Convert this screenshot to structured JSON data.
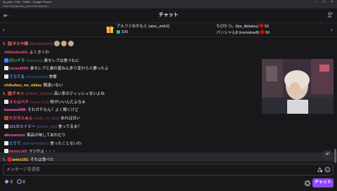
{
  "browser": {
    "title": "ky_yuko - Peer - Twitch - Google Chrome",
    "url": "twitch.tv/popout/ky_yuko/chat?popout="
  },
  "header": {
    "title": "チャット",
    "left_icon": "collapse-icon",
    "right_icon": "users-icon"
  },
  "gifters": [
    {
      "name": "アルファおかもと (atsu_shih2)",
      "count": "100",
      "badge": "sub"
    },
    {
      "name": "ちびたつ。(fps_tibitatsu)",
      "count": "50",
      "badge": "gem"
    },
    {
      "name": "パンシャん8 (iromokas8)",
      "count": "50",
      "badge": "gem"
    }
  ],
  "messages": [
    {
      "prefix": "5.",
      "name": "タヌキ鍋",
      "login": "(tanukikawa)",
      "text": ":",
      "color": "#ff6b6b",
      "badge": "#b0413e",
      "emotes": true
    },
    {
      "prefix": "",
      "name": "shitsuboo01",
      "login": "",
      "text": ": よくきくわ",
      "color": "#ff4f8b",
      "badge": ""
    },
    {
      "prefix": "",
      "name": "けいドラ",
      "login": "(keidora)",
      "text": ": 鼻セレブは食べもに",
      "color": "#39d98a",
      "badge": "#3b82f6"
    },
    {
      "prefix": "",
      "name": "lucas4000",
      "login": "",
      "text": ": 鼻セレブと鼻の羞ねん多り変わら人勝ったよ",
      "color": "#ff4f8b",
      "badge": "#e9e9ec"
    },
    {
      "prefix": "",
      "name": "てらてる",
      "login": "(teraterudo)",
      "text": ": 常備",
      "color": "#5b9bff",
      "badge": "#e9e9ec"
    },
    {
      "prefix": "",
      "name": "chikuhou_no_okina",
      "login": "",
      "text": ": 間違いない",
      "color": "#ffd24d",
      "badge": ""
    },
    {
      "prefix": "5.",
      "name": "チキン",
      "login": "(chiken_chichi)",
      "text": ": 高い系のティッシュ甘いよね",
      "color": "#ff6b6b",
      "badge": "#b0413e"
    },
    {
      "prefix": "",
      "name": "ヌル山ペチ",
      "login": "(nuru_bei)",
      "text": ": 粉がいいんだよなぁ",
      "color": "#ff4f8b",
      "badge": "#e9e9ec"
    },
    {
      "prefix": "",
      "name": "kaname098",
      "login": "",
      "text": ": それガチなん？よく聞くけど",
      "color": "#ff66cc",
      "badge": ""
    },
    {
      "prefix": "",
      "name": "ただのふぁん",
      "login": "(tada_no_fan)",
      "text": ": あれは甘い",
      "color": "#ff4f8b",
      "badge": "#b0413e"
    },
    {
      "prefix": "",
      "name": "101のスイミー",
      "login": "(sw1m_mi)",
      "text": ": 食ってるま？",
      "color": "#c77dff",
      "badge": "#e9e9ec"
    },
    {
      "prefix": "",
      "name": "abczunzun",
      "login": "",
      "text": ": 薬品の味してあれむり",
      "color": "#ff66cc",
      "badge": ""
    },
    {
      "prefix": "",
      "name": "とりて",
      "login": "(toteramodoin)",
      "text": ": 食ったことないわ",
      "color": "#5b9bff",
      "badge": "#e9e9ec"
    },
    {
      "prefix": "",
      "name": "nenocut0",
      "login": "",
      "text": ": マジかよ・・・",
      "color": "#ff4f8b",
      "badge": "#e9e9ec"
    },
    {
      "prefix": "5.",
      "name": "anko101",
      "login": "",
      "text": ": それは食べた",
      "color": "#ffd24d",
      "badge": "#e91916"
    }
  ],
  "input": {
    "placeholder": "メッセージを送信"
  },
  "footer": {
    "points": "0",
    "bits": "0",
    "chat_button": "チャット"
  }
}
